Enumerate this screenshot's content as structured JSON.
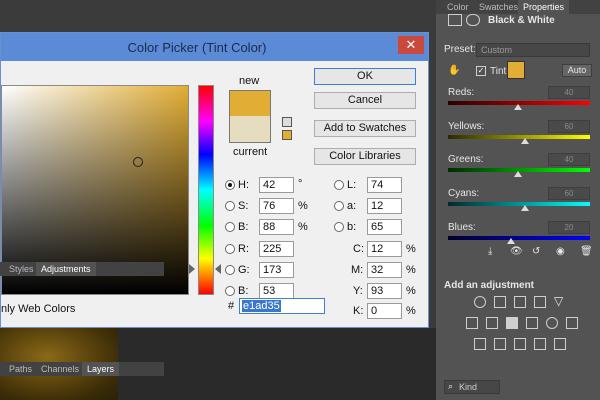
{
  "dialog": {
    "title": "Color Picker (Tint Color)",
    "close_glyph": "✕",
    "new_label": "new",
    "current_label": "current",
    "web_colors_label": "nly Web Colors",
    "buttons": {
      "ok": "OK",
      "cancel": "Cancel",
      "add_swatches": "Add to Swatches",
      "color_libraries": "Color Libraries"
    },
    "hsb": {
      "h": {
        "label": "H:",
        "value": "42",
        "unit": "°"
      },
      "s": {
        "label": "S:",
        "value": "76",
        "unit": "%"
      },
      "b": {
        "label": "B:",
        "value": "88",
        "unit": "%"
      }
    },
    "rgb": {
      "r": {
        "label": "R:",
        "value": "225"
      },
      "g": {
        "label": "G:",
        "value": "173"
      },
      "b": {
        "label": "B:",
        "value": "53"
      }
    },
    "lab": {
      "l": {
        "label": "L:",
        "value": "74"
      },
      "a": {
        "label": "a:",
        "value": "12"
      },
      "b": {
        "label": "b:",
        "value": "65"
      }
    },
    "cmyk": {
      "c": {
        "label": "C:",
        "value": "12",
        "unit": "%"
      },
      "m": {
        "label": "M:",
        "value": "32",
        "unit": "%"
      },
      "y": {
        "label": "Y:",
        "value": "93",
        "unit": "%"
      },
      "k": {
        "label": "K:",
        "value": "0",
        "unit": "%"
      }
    },
    "hex_label": "#",
    "hex_value": "e1ad35",
    "colors": {
      "new": "#e1ad35",
      "current": "#e6dcc0"
    }
  },
  "panel": {
    "tabs_top": [
      "Color",
      "Swatches",
      "Properties"
    ],
    "adjustment_title": "Black & White",
    "preset_label": "Preset:",
    "preset_value": "Custom",
    "tint_label": "Tint",
    "auto_label": "Auto",
    "sliders": [
      {
        "label": "Reds:",
        "value": "40"
      },
      {
        "label": "Yellows:",
        "value": "60"
      },
      {
        "label": "Greens:",
        "value": "40"
      },
      {
        "label": "Cyans:",
        "value": "60"
      },
      {
        "label": "Blues:",
        "value": "20"
      }
    ],
    "tabs_mid": [
      "Styles",
      "Adjustments"
    ],
    "add_adjustment": "Add an adjustment",
    "tabs_bottom": [
      "Paths",
      "Channels",
      "Layers"
    ],
    "kind_label": "Kind"
  }
}
